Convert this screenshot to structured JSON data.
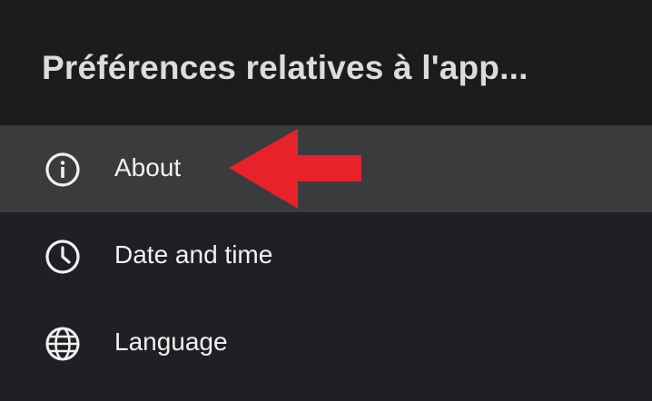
{
  "header": {
    "title": "Préférences relatives à l'app..."
  },
  "menu": {
    "items": [
      {
        "label": "About",
        "icon": "info-icon",
        "selected": true
      },
      {
        "label": "Date and time",
        "icon": "clock-icon",
        "selected": false
      },
      {
        "label": "Language",
        "icon": "globe-icon",
        "selected": false
      }
    ]
  },
  "annotation": {
    "icon": "red-arrow-icon",
    "color": "#e8222a"
  },
  "colors": {
    "background": "#1f2023",
    "header_background": "#1b1c1e",
    "selected_background": "#3a3b3d",
    "text": "#f1f1f1"
  }
}
